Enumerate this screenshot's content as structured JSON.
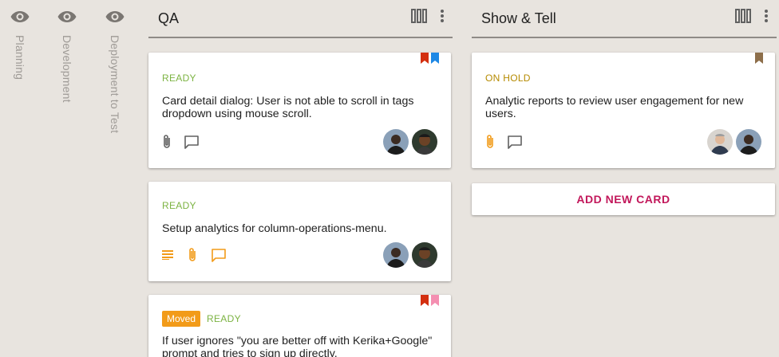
{
  "collapsed_columns": [
    {
      "label": "Planning"
    },
    {
      "label": "Development"
    },
    {
      "label": "Deployment to Test"
    }
  ],
  "columns": [
    {
      "title": "QA",
      "cards": [
        {
          "status": "READY",
          "title": "Card detail dialog: User is not able to scroll in tags dropdown using mouse scroll.",
          "flags": [
            "#d32f0f",
            "#1e88e5"
          ]
        },
        {
          "status": "READY",
          "title": "Setup analytics for column-operations-menu.",
          "flags": []
        },
        {
          "badge": "Moved",
          "status": "READY",
          "title": "If user ignores \"you are better off with Kerika+Google\" prompt and tries to sign up directly,",
          "flags": [
            "#d32f0f",
            "#f48fb1"
          ]
        }
      ]
    },
    {
      "title": "Show & Tell",
      "cards": [
        {
          "status": "ON HOLD",
          "title": "Analytic reports to review user engagement for new users.",
          "flags": [
            "#8d6e4a"
          ]
        }
      ],
      "add_card_label": "ADD NEW CARD"
    }
  ],
  "colors": {
    "background": "#e8e4df",
    "ready": "#7cb342",
    "on_hold": "#b58a00",
    "accent": "#c2185b",
    "attachment_active": "#f29b19",
    "icon_grey": "#616161"
  },
  "icons": [
    "eye-icon",
    "column-icon",
    "more-vert-icon",
    "attachment-icon",
    "chat-icon",
    "description-icon",
    "bookmark-icon"
  ]
}
